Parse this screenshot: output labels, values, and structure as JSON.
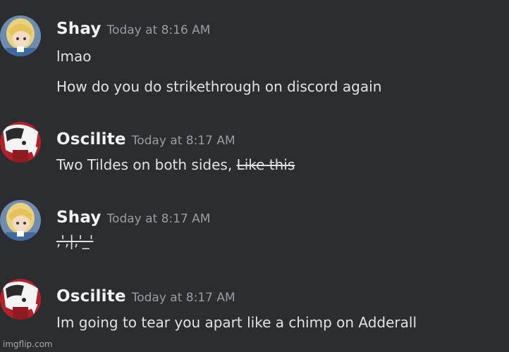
{
  "messages": [
    {
      "username": "Shay",
      "timestamp": "Today at 8:16 AM",
      "avatar_icon": "shay-avatar-icon",
      "lines": [
        "lmao",
        "How do you do strikethrough on discord again"
      ]
    },
    {
      "username": "Oscilite",
      "timestamp": "Today at 8:17 AM",
      "avatar_icon": "oscilite-avatar-icon",
      "text_prefix": "Two Tildes on both sides, ",
      "strike_text": "Like this"
    },
    {
      "username": "Shay",
      "timestamp": "Today at 8:17 AM",
      "avatar_icon": "shay-avatar-icon",
      "symbol_text": ",',|,'_'"
    },
    {
      "username": "Oscilite",
      "timestamp": "Today at 8:17 AM",
      "avatar_icon": "oscilite-avatar-icon",
      "lines": [
        "Im going to tear you apart like a chimp on Adderall"
      ]
    }
  ],
  "watermark": "imgflip.com",
  "colors": {
    "background": "#2c2d31",
    "username": "#f2f3f5",
    "timestamp": "#9a9ca3",
    "text": "#e1e2e6"
  }
}
